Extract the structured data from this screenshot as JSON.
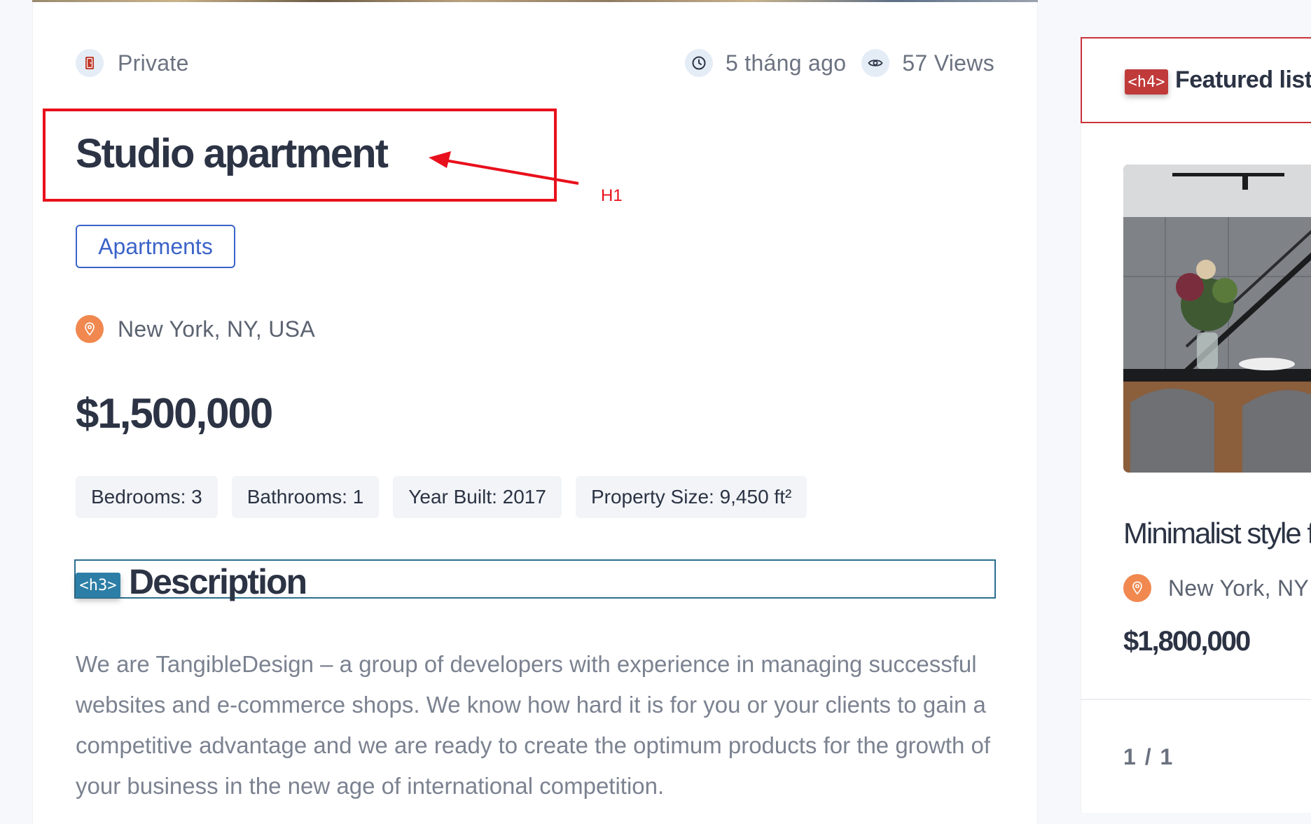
{
  "property": {
    "status": "Private",
    "posted": "5 tháng ago",
    "views": "57 Views",
    "title": "Studio apartment",
    "category": "Apartments",
    "location": "New York, NY, USA",
    "price": "$1,500,000",
    "features": [
      "Bedrooms: 3",
      "Bathrooms: 1",
      "Year Built: 2017",
      "Property Size: 9,450 ft²"
    ]
  },
  "description": {
    "tag": "<h3>",
    "heading": "Description",
    "body": "We are TangibleDesign – a group of developers with experience in managing successful websites and e-commerce shops. We know how hard it is for you or your clients to gain a competitive advantage and we are ready to create the optimum products for the growth of your business in the new age of international competition."
  },
  "annotation": {
    "label": "H1",
    "color": "#e8101c"
  },
  "sidebar": {
    "tag": "<h4>",
    "title": "Featured listi",
    "listing": {
      "title": "Minimalist style f",
      "location": "New York, NY",
      "price": "$1,800,000"
    },
    "pager": "1 / 1"
  },
  "icons": {
    "status": "door-icon",
    "posted": "clock-icon",
    "views": "eye-icon",
    "location": "map-pin-icon"
  },
  "colors": {
    "accent_blue": "#3b63c9",
    "pin_orange": "#f0884f",
    "h3_badge": "#2c7ea6",
    "h4_badge": "#c13a3a"
  }
}
